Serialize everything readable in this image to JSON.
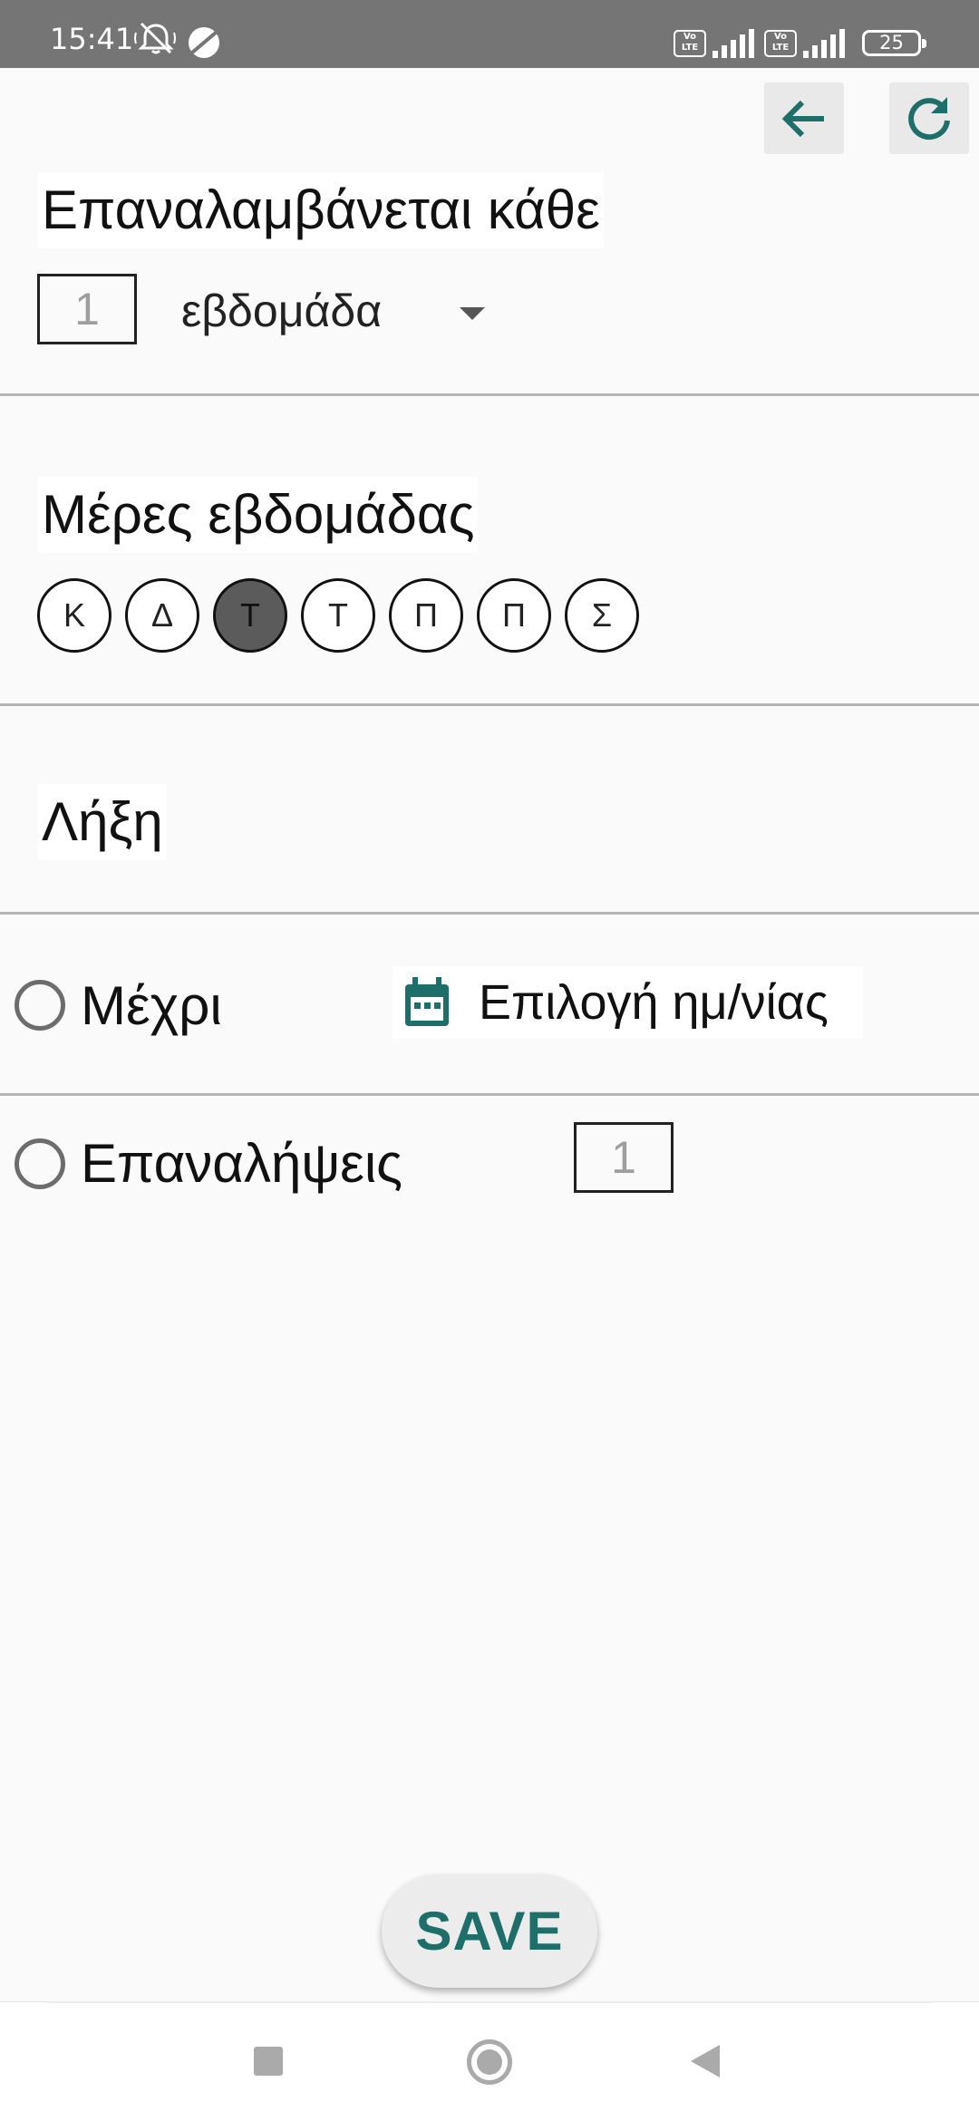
{
  "status_bar": {
    "time": "15:41",
    "battery": "25",
    "lte1": "Vo LTE",
    "lte2": "Vo LTE",
    "icons": [
      "mute-vibrate-icon",
      "satellite-icon",
      "volte-icon",
      "signal-icon",
      "volte-icon",
      "signal-icon",
      "battery-icon"
    ]
  },
  "toolbar": {
    "back_icon": "arrow-left-icon",
    "refresh_icon": "refresh-icon",
    "accent_color": "#1e6e6a"
  },
  "repeat": {
    "title": "Επαναλαμβάνεται κάθε",
    "interval_value": "1",
    "unit": "εβδομάδα"
  },
  "weekdays": {
    "title": "Μέρες εβδομάδας",
    "days": [
      {
        "label": "Κ",
        "selected": false
      },
      {
        "label": "Δ",
        "selected": false
      },
      {
        "label": "Τ",
        "selected": true
      },
      {
        "label": "Τ",
        "selected": false
      },
      {
        "label": "Π",
        "selected": false
      },
      {
        "label": "Π",
        "selected": false
      },
      {
        "label": "Σ",
        "selected": false
      }
    ]
  },
  "end": {
    "title": "Λήξη",
    "until_label": "Μέχρι",
    "date_button_label": "Επιλογή ημ/νίας",
    "count_label": "Επαναλήψεις",
    "count_value": "1"
  },
  "save": {
    "label": "SAVE"
  }
}
